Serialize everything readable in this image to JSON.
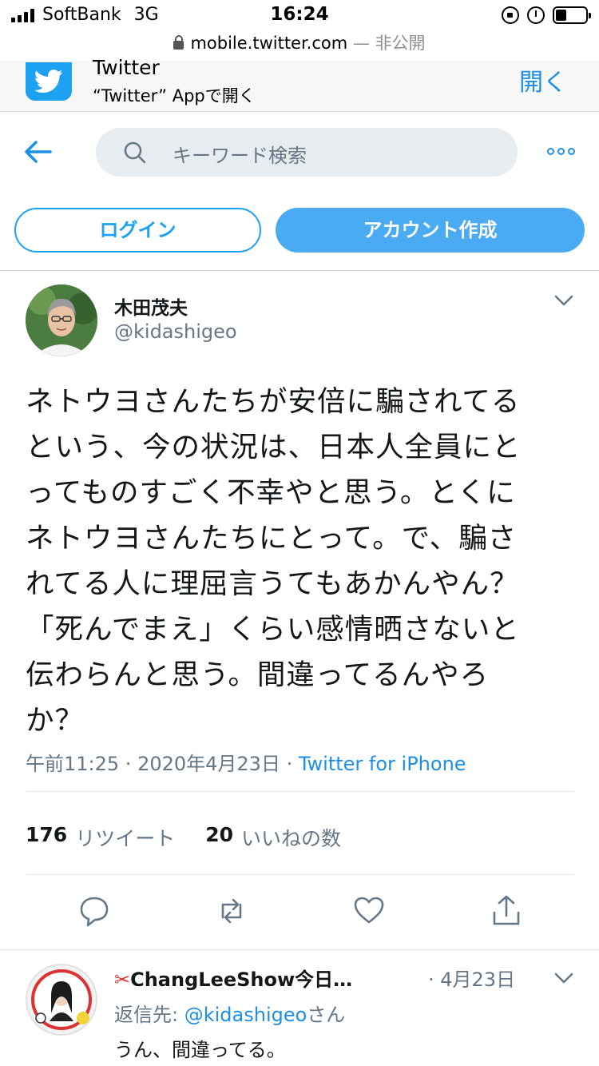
{
  "status_bar": {
    "carrier": "SoftBank",
    "network": "3G",
    "time": "16:24"
  },
  "url_bar": {
    "domain": "mobile.twitter.com",
    "separator": " — ",
    "privacy": "非公開"
  },
  "app_banner": {
    "title": "Twitter",
    "subtitle": "“Twitter” Appで開く",
    "open_label": "開く"
  },
  "search": {
    "placeholder": "キーワード検索"
  },
  "auth": {
    "login_label": "ログイン",
    "signup_label": "アカウント作成"
  },
  "tweet": {
    "author_name": "木田茂夫",
    "author_handle": "@kidashigeo",
    "text": "ネトウヨさんたちが安倍に騙されてる\nという、今の状況は、日本人全員にと\nってものすごく不幸やと思う。とくに\nネトウヨさんたちにとって。で、騙さ\nれてる人に理屈言うてもあかんやん？\n「死んでまえ」くらい感情晒さないと\n伝わらんと思う。間違ってるんやろ\nか？",
    "time": "午前11:25",
    "date": "2020年4月23日",
    "dot": " · ",
    "via": "Twitter for iPhone",
    "retweet_count": "176",
    "retweet_label": "リツイート",
    "like_count": "20",
    "like_label": "いいねの数"
  },
  "reply": {
    "author_name": "ChangLeeShow今日…",
    "date": "· 4月23日",
    "reply_prefix": "返信先: ",
    "reply_mention": "@kidashigeo",
    "reply_suffix": "さん",
    "text": "うん、間違ってる。"
  },
  "colors": {
    "accent": "#1da1f2",
    "link": "#1d8fe6",
    "muted": "#657786"
  }
}
